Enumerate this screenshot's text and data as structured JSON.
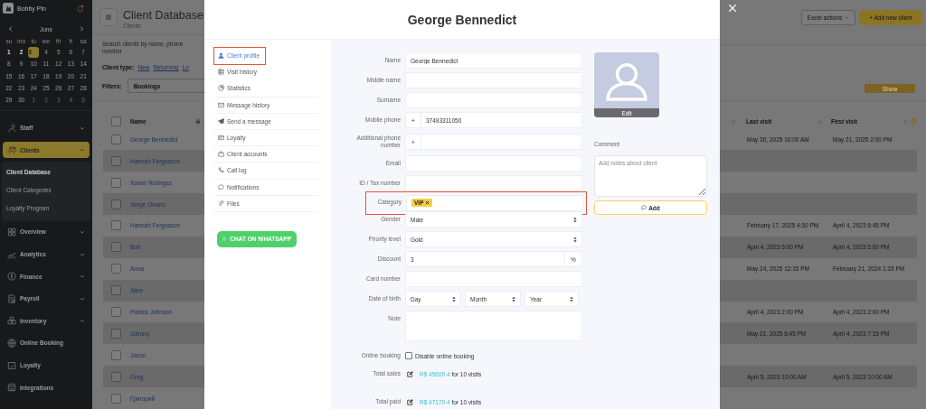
{
  "sidebar": {
    "brand": "Bobby Pin",
    "calendar": {
      "month": "June",
      "weekdays": [
        "su",
        "mo",
        "tu",
        "we",
        "th",
        "fr",
        "sa"
      ],
      "days": [
        {
          "label": "1",
          "kind": "marked",
          "selected": false
        },
        {
          "label": "2",
          "kind": "marked",
          "selected": false
        },
        {
          "label": "3",
          "kind": "marked",
          "selected": true
        },
        {
          "label": "4",
          "kind": "normal",
          "selected": false
        },
        {
          "label": "5",
          "kind": "normal",
          "selected": false
        },
        {
          "label": "6",
          "kind": "normal",
          "selected": false
        },
        {
          "label": "7",
          "kind": "normal",
          "selected": false
        },
        {
          "label": "8",
          "kind": "normal",
          "selected": false
        },
        {
          "label": "9",
          "kind": "normal",
          "selected": false
        },
        {
          "label": "10",
          "kind": "normal",
          "selected": false
        },
        {
          "label": "11",
          "kind": "normal",
          "selected": false
        },
        {
          "label": "12",
          "kind": "normal",
          "selected": false
        },
        {
          "label": "13",
          "kind": "normal",
          "selected": false
        },
        {
          "label": "14",
          "kind": "normal",
          "selected": false
        },
        {
          "label": "15",
          "kind": "normal",
          "selected": false
        },
        {
          "label": "16",
          "kind": "normal",
          "selected": false
        },
        {
          "label": "17",
          "kind": "normal",
          "selected": false
        },
        {
          "label": "18",
          "kind": "normal",
          "selected": false
        },
        {
          "label": "19",
          "kind": "normal",
          "selected": false
        },
        {
          "label": "20",
          "kind": "normal",
          "selected": false
        },
        {
          "label": "21",
          "kind": "normal",
          "selected": false
        },
        {
          "label": "22",
          "kind": "normal",
          "selected": false
        },
        {
          "label": "23",
          "kind": "normal",
          "selected": false
        },
        {
          "label": "24",
          "kind": "normal",
          "selected": false
        },
        {
          "label": "25",
          "kind": "normal",
          "selected": false
        },
        {
          "label": "26",
          "kind": "normal",
          "selected": false
        },
        {
          "label": "27",
          "kind": "normal",
          "selected": false
        },
        {
          "label": "28",
          "kind": "normal",
          "selected": false
        },
        {
          "label": "29",
          "kind": "normal",
          "selected": false
        },
        {
          "label": "30",
          "kind": "normal",
          "selected": false
        },
        {
          "label": "1",
          "kind": "outside",
          "selected": false
        },
        {
          "label": "2",
          "kind": "outside",
          "selected": false
        },
        {
          "label": "3",
          "kind": "outside",
          "selected": false
        },
        {
          "label": "4",
          "kind": "outside",
          "selected": false
        },
        {
          "label": "5",
          "kind": "outside",
          "selected": false
        }
      ]
    },
    "menu": [
      {
        "label": "Staff",
        "selected": false,
        "expanded": false
      },
      {
        "label": "Clients",
        "selected": true,
        "expanded": true,
        "children": [
          {
            "label": "Client Database",
            "selected": true
          },
          {
            "label": "Client Categories",
            "selected": false
          },
          {
            "label": "Loyalty Program",
            "selected": false
          }
        ]
      },
      {
        "label": "Overview",
        "selected": false,
        "expanded": false
      },
      {
        "label": "Analytics",
        "selected": false,
        "expanded": false
      },
      {
        "label": "Finance",
        "selected": false,
        "expanded": false
      },
      {
        "label": "Payroll",
        "selected": false,
        "expanded": false
      },
      {
        "label": "Inventory",
        "selected": false,
        "expanded": false
      },
      {
        "label": "Online Booking",
        "selected": false
      },
      {
        "label": "Loyalty",
        "selected": false
      },
      {
        "label": "Integrations",
        "selected": false
      }
    ]
  },
  "page": {
    "title": "Client Database",
    "breadcrumb": "Clients",
    "search_placeholder": "Search clients by name, phone number",
    "client_type_label": "Client type:",
    "client_types": [
      "New",
      "Returning",
      "Lo"
    ],
    "filters_label": "Filters:",
    "filter_value": "Bookings",
    "excel_actions": "Excel actions",
    "add_client": "+ Add new client",
    "show_button": "Show"
  },
  "table": {
    "columns": [
      {
        "label": "Name"
      },
      {
        "label": "Last visit"
      },
      {
        "label": "First visit"
      }
    ],
    "select_all_checked": false,
    "rows": [
      {
        "name": "George Bennedict",
        "checked": false,
        "last_visit": "May 30, 2025 10:00 AM",
        "first_visit": "May 21, 2025 2:00 PM"
      },
      {
        "name": "Hannah Fergusson",
        "checked": false
      },
      {
        "name": "Xavier Rodrigez",
        "checked": false
      },
      {
        "name": "Serge Omaro",
        "checked": false
      },
      {
        "name": "Hannah Fergusson",
        "checked": false,
        "last_visit": "February 17, 2025 4:30 PM",
        "first_visit": "April 4, 2023 6:45 PM"
      },
      {
        "name": "Bob",
        "checked": false,
        "last_visit": "April 4, 2023 5:00 PM",
        "first_visit": "April 4, 2023 5:00 PM"
      },
      {
        "name": "Anna",
        "checked": false,
        "last_visit": "May 24, 2025 12:15 PM",
        "first_visit": "February 21, 2024 1:15 PM"
      },
      {
        "name": "Jane",
        "checked": false
      },
      {
        "name": "Patrick Johnson",
        "checked": false,
        "last_visit": "April 4, 2023 2:00 PM",
        "first_visit": "April 4, 2023 2:00 PM"
      },
      {
        "name": "Johnny",
        "checked": false,
        "last_visit": "May 21, 2025 6:45 PM",
        "first_visit": "April 4, 2023 7:15 PM"
      },
      {
        "name": "Jason",
        "checked": false
      },
      {
        "name": "Greg",
        "checked": false,
        "last_visit": "April 5, 2023 10:00 AM",
        "first_visit": "April 5, 2023 10:00 AM"
      },
      {
        "name": "Григорий",
        "checked": false
      }
    ]
  },
  "modal": {
    "title": "George Bennedict",
    "nav": [
      {
        "label": "Client profile",
        "selected": true,
        "highlighted": true
      },
      {
        "label": "Visit history",
        "selected": false,
        "highlighted": false
      },
      {
        "label": "Statistics",
        "selected": false,
        "highlighted": false
      },
      {
        "label": "Message history",
        "selected": false,
        "highlighted": false
      },
      {
        "label": "Send a message",
        "selected": false,
        "highlighted": false
      },
      {
        "label": "Loyalty",
        "selected": false,
        "highlighted": false
      },
      {
        "label": "Client accounts",
        "selected": false,
        "highlighted": false
      },
      {
        "label": "Call log",
        "selected": false,
        "highlighted": false
      },
      {
        "label": "Notifications",
        "selected": false,
        "highlighted": false
      },
      {
        "label": "Files",
        "selected": false,
        "highlighted": false
      }
    ],
    "whatsapp_button": "CHAT ON WHATSAPP",
    "form": [
      {
        "kind": "text",
        "label": "Name",
        "value": "George Bennedict",
        "highlighted": false
      },
      {
        "kind": "text",
        "label": "Middle name",
        "highlighted": false
      },
      {
        "kind": "text",
        "label": "Surname",
        "highlighted": false
      },
      {
        "kind": "phone",
        "label": "Mobile phone",
        "prefix": "+",
        "value": "37493311050",
        "highlighted": false
      },
      {
        "kind": "phone",
        "label": "Additional phone number",
        "prefix": "+",
        "highlighted": false
      },
      {
        "kind": "text",
        "label": "Email",
        "highlighted": false
      },
      {
        "kind": "text",
        "label": "ID / Tax number",
        "highlighted": false
      },
      {
        "kind": "tags",
        "label": "Category",
        "tags": [
          "VIP"
        ],
        "highlighted": true
      },
      {
        "kind": "select",
        "label": "Gender",
        "value": "Male",
        "highlighted": false
      },
      {
        "kind": "select",
        "label": "Priority level",
        "value": "Gold",
        "highlighted": false
      },
      {
        "kind": "suffix",
        "label": "Discount",
        "value": "3",
        "suffix": "%",
        "highlighted": false
      },
      {
        "kind": "text",
        "label": "Card number",
        "highlighted": false
      },
      {
        "kind": "selects",
        "label": "Date of birth",
        "values": [
          "Day",
          "Month",
          "Year"
        ],
        "highlighted": false
      },
      {
        "kind": "textarea",
        "label": "Note",
        "highlighted": false
      },
      {
        "kind": "checkbox",
        "label": "Online booking",
        "text": "Disable online booking",
        "checked": false,
        "highlighted": false
      },
      {
        "kind": "amount",
        "label": "Total sales",
        "amount": "R$ 45600.4",
        "detail": "for 10 visits",
        "highlighted": false
      },
      {
        "kind": "amount",
        "label": "Total paid",
        "amount": "R$ 47170.4",
        "detail": "for 10 visits",
        "highlighted": false
      }
    ],
    "photo": {
      "edit": "Edit"
    },
    "comment": {
      "label": "Comment",
      "placeholder": "Add notes about client",
      "button": "Add"
    }
  }
}
